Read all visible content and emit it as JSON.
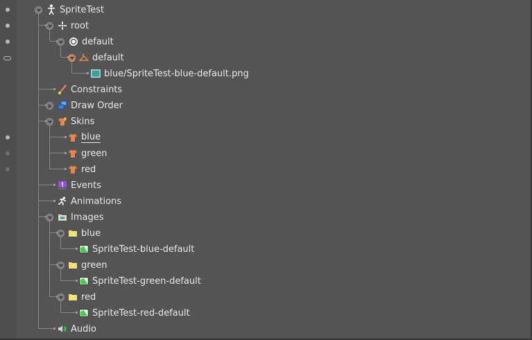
{
  "tree": {
    "nodes": [
      {
        "label": "SpriteTest",
        "icon": "skeleton-icon",
        "vis": "dot"
      },
      {
        "label": "root",
        "icon": "bone-icon",
        "vis": "dot"
      },
      {
        "label": "default",
        "icon": "slot-icon",
        "vis": "dot"
      },
      {
        "label": "default",
        "icon": "skin-placeholder-icon",
        "vis": "link"
      },
      {
        "label": "blue/SpriteTest-blue-default.png",
        "icon": "region-attachment-icon",
        "vis": "none"
      },
      {
        "label": "Constraints",
        "icon": "constraints-icon",
        "vis": "none"
      },
      {
        "label": "Draw Order",
        "icon": "draw-order-icon",
        "vis": "none"
      },
      {
        "label": "Skins",
        "icon": "skins-icon",
        "vis": "none"
      },
      {
        "label": "blue",
        "icon": "skin-icon",
        "vis": "dot"
      },
      {
        "label": "green",
        "icon": "skin-icon",
        "vis": "dim"
      },
      {
        "label": "red",
        "icon": "skin-icon",
        "vis": "dim"
      },
      {
        "label": "Events",
        "icon": "events-icon",
        "vis": "none"
      },
      {
        "label": "Animations",
        "icon": "animations-icon",
        "vis": "none"
      },
      {
        "label": "Images",
        "icon": "images-icon",
        "vis": "none"
      },
      {
        "label": "blue",
        "icon": "folder-icon",
        "vis": "none"
      },
      {
        "label": "SpriteTest-blue-default",
        "icon": "image-icon",
        "vis": "none"
      },
      {
        "label": "green",
        "icon": "folder-icon",
        "vis": "none"
      },
      {
        "label": "SpriteTest-green-default",
        "icon": "image-icon",
        "vis": "none"
      },
      {
        "label": "red",
        "icon": "folder-icon",
        "vis": "none"
      },
      {
        "label": "SpriteTest-red-default",
        "icon": "image-icon",
        "vis": "none"
      },
      {
        "label": "Audio",
        "icon": "audio-icon",
        "vis": "none"
      }
    ]
  },
  "colors": {
    "panel_bg": "#545454",
    "text": "#e8e8e8",
    "skin_orange": "#e8854a",
    "folder_yellow": "#f2e27a",
    "image_green": "#3fd23f"
  }
}
